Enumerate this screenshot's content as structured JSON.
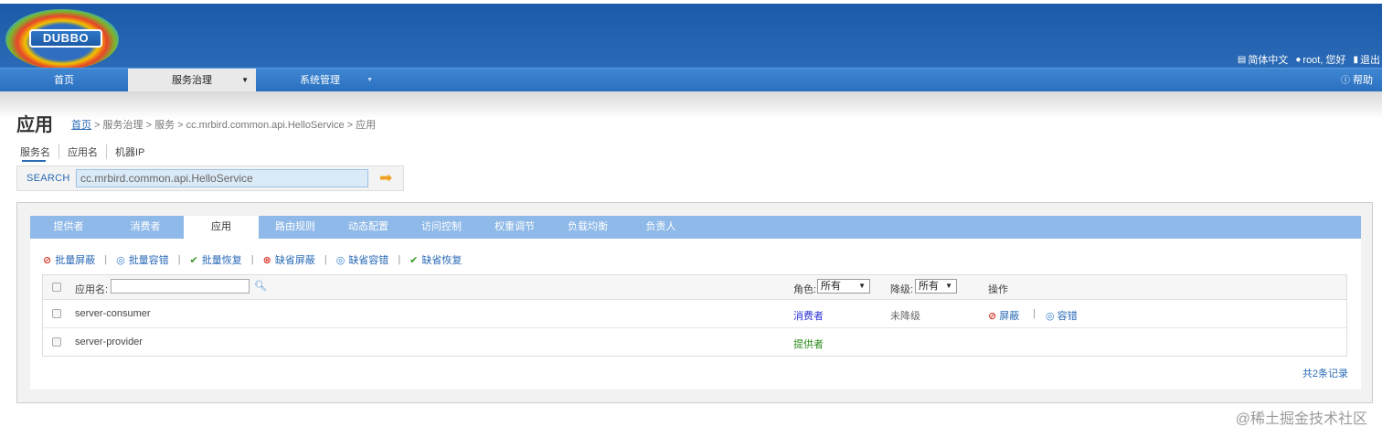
{
  "header": {
    "logo_text": "DUBBO",
    "language": "简体中文",
    "user_greeting": "root, 您好",
    "logout": "退出"
  },
  "nav": {
    "items": [
      {
        "label": "首页"
      },
      {
        "label": "服务治理",
        "dropdown": "▼"
      },
      {
        "label": "系统管理",
        "dropdown": "▼"
      }
    ],
    "help": "帮助"
  },
  "page": {
    "title": "应用",
    "breadcrumb": {
      "home": "首页",
      "rest": "> 服务治理 > 服务 > cc.mrbird.common.api.HelloService > 应用"
    }
  },
  "search": {
    "tabs": [
      "服务名",
      "应用名",
      "机器IP"
    ],
    "label": "SEARCH",
    "value": "cc.mrbird.common.api.HelloService"
  },
  "panel": {
    "tabs": [
      "提供者",
      "消费者",
      "应用",
      "路由规则",
      "动态配置",
      "访问控制",
      "权重调节",
      "负载均衡",
      "负责人"
    ],
    "active_tab": "应用",
    "actions": [
      "批量屏蔽",
      "批量容错",
      "批量恢复",
      "缺省屏蔽",
      "缺省容错",
      "缺省恢复"
    ],
    "table": {
      "col_app": "应用名:",
      "col_role": "角色:",
      "role_filter": "所有",
      "col_degrade": "降级:",
      "degrade_filter": "所有",
      "col_ops": "操作",
      "rows": [
        {
          "app": "server-consumer",
          "role": "消费者",
          "degrade": "未降级",
          "op1": "屏蔽",
          "op2": "容错"
        },
        {
          "app": "server-provider",
          "role": "提供者",
          "degrade": "",
          "op1": "",
          "op2": ""
        }
      ]
    },
    "footer": "共2条记录"
  },
  "watermark": "@稀土掘金技术社区"
}
